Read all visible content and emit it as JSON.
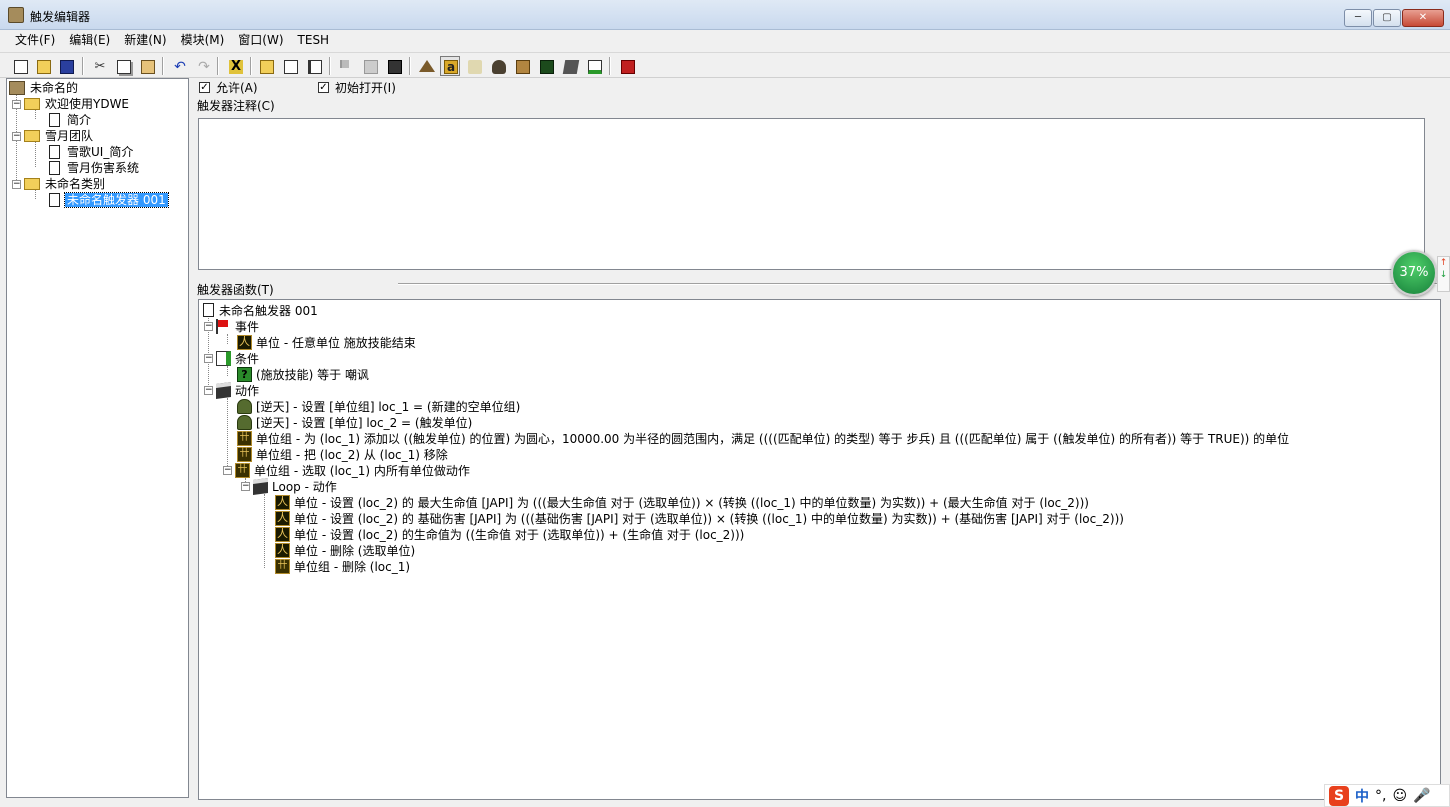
{
  "window": {
    "title": "触发编辑器"
  },
  "window_controls": {
    "minimize": "─",
    "maximize": "▢",
    "close": "✕"
  },
  "menu": [
    "文件(F)",
    "编辑(E)",
    "新建(N)",
    "模块(M)",
    "窗口(W)",
    "TESH"
  ],
  "toolbar_icons": [
    "new-doc",
    "open-folder",
    "save-disk",
    "cut",
    "copy",
    "paste",
    "undo",
    "redo",
    "close-x",
    "folder",
    "new-trigger",
    "list",
    "flag",
    "gray",
    "clapper",
    "terrain",
    "text-a",
    "sound",
    "mask",
    "hud",
    "green-grid",
    "box",
    "doc-green",
    "red-check"
  ],
  "left_tree": {
    "root": "未命名的",
    "items": [
      {
        "label": "欢迎使用YDWE",
        "type": "folder"
      },
      {
        "label": "简介",
        "type": "doc"
      },
      {
        "label": "雪月团队",
        "type": "folder"
      },
      {
        "label": "雪歌UI_简介",
        "type": "doc"
      },
      {
        "label": "雪月伤害系统",
        "type": "doc"
      },
      {
        "label": "未命名类别",
        "type": "folder"
      },
      {
        "label": "未命名触发器 001",
        "type": "doc",
        "selected": true
      }
    ]
  },
  "options": {
    "enabled_label": "允许(A)",
    "enabled_mark": "✓",
    "initially_on_label": "初始打开(I)",
    "initially_on_mark": "✓"
  },
  "comment_label": "触发器注释(C)",
  "functions_label": "触发器函数(T)",
  "function_tree": {
    "trigger_name": "未命名触发器 001",
    "events_label": "事件",
    "event_1": "单位 - 任意单位 施放技能结束",
    "conditions_label": "条件",
    "condition_1": "(施放技能) 等于 嘲讽",
    "actions_label": "动作",
    "action_1": "[逆天] - 设置 [单位组] loc_1 = (新建的空单位组)",
    "action_2": "[逆天] - 设置 [单位] loc_2 = (触发单位)",
    "action_3": "单位组 - 为 (loc_1) 添加以 ((触发单位) 的位置) 为圆心，10000.00 为半径的圆范围内，满足 ((((匹配单位) 的类型) 等于 步兵) 且 (((匹配单位) 属于 ((触发单位) 的所有者)) 等于 TRUE)) 的单位",
    "action_4": "单位组 - 把 (loc_2) 从 (loc_1) 移除",
    "action_5": "单位组 - 选取 (loc_1) 内所有单位做动作",
    "loop_label": "Loop - 动作",
    "loop_1": "单位 - 设置 (loc_2) 的 最大生命值 [JAPI] 为 (((最大生命值 对于 (选取单位)) × (转换 ((loc_1) 中的单位数量) 为实数)) + (最大生命值 对于 (loc_2)))",
    "loop_2": "单位 - 设置 (loc_2) 的 基础伤害 [JAPI] 为 (((基础伤害 [JAPI] 对于 (选取单位)) × (转换 ((loc_1) 中的单位数量) 为实数)) + (基础伤害 [JAPI] 对于 (loc_2)))",
    "loop_3": "单位 - 设置 (loc_2) 的生命值为 ((生命值 对于 (选取单位)) + (生命值 对于 (loc_2)))",
    "loop_4": "单位 - 删除 (选取单位)",
    "loop_5": "单位组 - 删除 (loc_1)"
  },
  "widget": {
    "percent": "37%",
    "up": "↑",
    "down": "↓"
  },
  "ime": {
    "logo": "S",
    "lang": "中",
    "punct": "°,",
    "emoji": "☺",
    "mic": "🎤"
  }
}
